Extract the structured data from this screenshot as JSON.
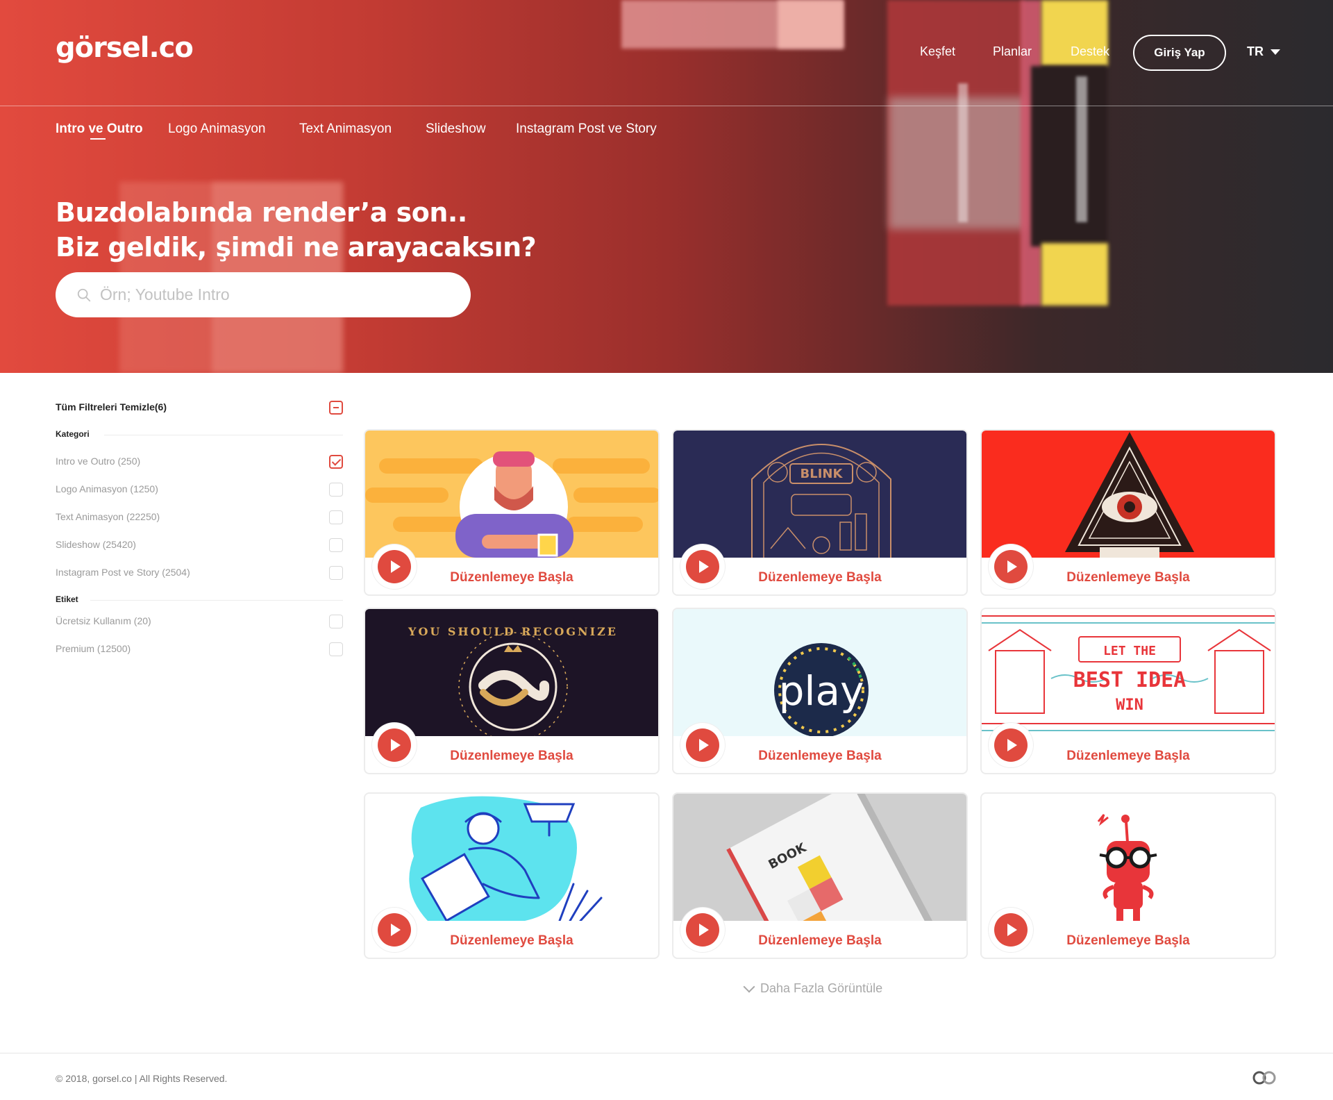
{
  "brand": {
    "logo": "görsel.co",
    "accent": "#e04a3f"
  },
  "header": {
    "nav": [
      "Keşfet",
      "Planlar",
      "Destek"
    ],
    "login_label": "Giriş Yap",
    "language": "TR"
  },
  "categories": {
    "tabs": [
      "Intro ve Outro",
      "Logo Animasyon",
      "Text Animasyon",
      "Slideshow",
      "Instagram Post ve Story"
    ],
    "active": "Intro ve Outro"
  },
  "hero": {
    "headline_line1": "Buzdolabında render’a son..",
    "headline_line2": "Biz geldik, şimdi ne arayacaksın?",
    "search_placeholder": "Örn; Youtube Intro",
    "search_value": ""
  },
  "filters": {
    "clear_label": "Tüm Filtreleri Temizle(6)",
    "groups": [
      {
        "title": "Kategori",
        "items": [
          {
            "label": "Intro ve Outro (250)",
            "checked": true
          },
          {
            "label": "Logo Animasyon (1250)",
            "checked": false
          },
          {
            "label": "Text Animasyon (22250)",
            "checked": false
          },
          {
            "label": "Slideshow (25420)",
            "checked": false
          },
          {
            "label": "Instagram Post ve Story (2504)",
            "checked": false
          }
        ]
      },
      {
        "title": "Etiket",
        "items": [
          {
            "label": "Ücretsiz Kullanım (20)",
            "checked": false
          },
          {
            "label": "Premium (12500)",
            "checked": false
          }
        ]
      }
    ]
  },
  "cards": [
    {
      "cta": "Düzenlemeye Başla",
      "thumb": "bearded-man-illustration",
      "bg": "#fdc65d"
    },
    {
      "cta": "Düzenlemeye Başla",
      "thumb": "blink-line-art",
      "bg": "#2a2b55",
      "text": "BLINK"
    },
    {
      "cta": "Düzenlemeye Başla",
      "thumb": "pyramid-eye",
      "bg": "#fa2c1e"
    },
    {
      "cta": "Düzenlemeye Başla",
      "thumb": "snake-badge",
      "bg": "#1d1426",
      "text": "YOU SHOULD RECOGNIZE"
    },
    {
      "cta": "Düzenlemeye Başla",
      "thumb": "play-logo",
      "bg": "#eaf9fb",
      "text": "play"
    },
    {
      "cta": "Düzenlemeye Başla",
      "thumb": "let-the-best-idea-win",
      "bg": "#ffffff",
      "text_lines": [
        "LET THE",
        "BEST IDEA",
        "WIN"
      ]
    },
    {
      "cta": "Düzenlemeye Başla",
      "thumb": "man-drawing-illustration",
      "bg": "#ffffff"
    },
    {
      "cta": "Düzenlemeye Başla",
      "thumb": "book-mockup",
      "bg": "#d0d0d0",
      "text": "BOOK"
    },
    {
      "cta": "Düzenlemeye Başla",
      "thumb": "red-robot-glasses",
      "bg": "#ffffff"
    }
  ],
  "load_more": "Daha Fazla Görüntüle",
  "footer": {
    "copyright": "© 2018, gorsel.co  | All Rights Reserved."
  }
}
